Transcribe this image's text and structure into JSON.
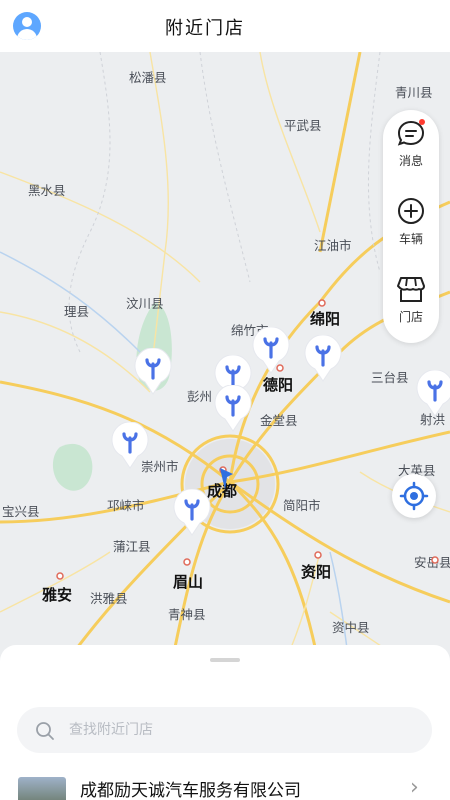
{
  "header": {
    "title": "附近门店",
    "avatar_icon": "user-icon"
  },
  "map": {
    "places": [
      {
        "id": "songpan",
        "label": "松潘县"
      },
      {
        "id": "qingchuan",
        "label": "青川县"
      },
      {
        "id": "pingwu",
        "label": "平武县"
      },
      {
        "id": "heishui",
        "label": "黑水县"
      },
      {
        "id": "jiangyou",
        "label": "江油市"
      },
      {
        "id": "lixian",
        "label": "理县"
      },
      {
        "id": "wenchuan",
        "label": "汶川县"
      },
      {
        "id": "mianzhu",
        "label": "绵竹市"
      },
      {
        "id": "mianyang",
        "label": "绵阳"
      },
      {
        "id": "santai",
        "label": "三台县"
      },
      {
        "id": "deyang",
        "label": "德阳"
      },
      {
        "id": "pengzhou",
        "label": "彭州"
      },
      {
        "id": "shehong",
        "label": "射洪"
      },
      {
        "id": "jintang",
        "label": "金堂县"
      },
      {
        "id": "chongzhou",
        "label": "崇州市"
      },
      {
        "id": "dayingxian",
        "label": "大英县"
      },
      {
        "id": "chengdu",
        "label": "成都"
      },
      {
        "id": "baoxing",
        "label": "宝兴县"
      },
      {
        "id": "qionglai",
        "label": "邛崃市"
      },
      {
        "id": "jianyang",
        "label": "简阳市"
      },
      {
        "id": "pujiang",
        "label": "蒲江县"
      },
      {
        "id": "anyue",
        "label": "安岳县"
      },
      {
        "id": "meishan",
        "label": "眉山"
      },
      {
        "id": "ziyang",
        "label": "资阳"
      },
      {
        "id": "yaan",
        "label": "雅安"
      },
      {
        "id": "hongya",
        "label": "洪雅县"
      },
      {
        "id": "qingshen",
        "label": "青神县"
      },
      {
        "id": "zizhong",
        "label": "资中县"
      }
    ],
    "store_pin_count": 8,
    "pin_icon": "wrench-icon",
    "pin_color": "#4a72e6"
  },
  "controls": {
    "message": {
      "label": "消息",
      "icon": "message-icon",
      "badge_color": "#ff3b30"
    },
    "vehicle": {
      "label": "车辆",
      "icon": "add-circle-icon"
    },
    "store": {
      "label": "门店",
      "icon": "store-icon"
    },
    "locate_icon": "locate-icon"
  },
  "sheet": {
    "search_placeholder": "查找附近门店",
    "store_name": "成都励天诚汽车服务有限公司"
  }
}
